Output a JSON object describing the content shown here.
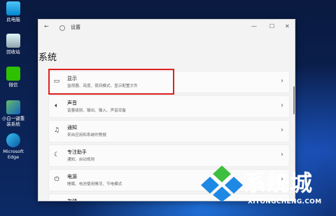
{
  "desktop": {
    "icons": [
      {
        "label": "此电脑"
      },
      {
        "label": "回收站"
      },
      {
        "label": "微信"
      },
      {
        "label": "小白一键重装系统"
      },
      {
        "label": "Microsoft Edge"
      }
    ]
  },
  "window": {
    "title": "设置",
    "controls": {
      "minimize": "—",
      "maximize": "☐",
      "close": "✕"
    },
    "nav": {
      "back": "←"
    }
  },
  "page": {
    "title": "系统"
  },
  "items": [
    {
      "title": "显示",
      "subtitle": "监视器、亮度、夜间模式、显示配置文件",
      "icon": "display-icon"
    },
    {
      "title": "声音",
      "subtitle": "音量级别、输出、输入、声音设备",
      "icon": "speaker-icon"
    },
    {
      "title": "通知",
      "subtitle": "来自应用和系统的警报",
      "icon": "bell-icon"
    },
    {
      "title": "专注助手",
      "subtitle": "通知、自动规则",
      "icon": "moon-icon"
    },
    {
      "title": "电源",
      "subtitle": "睡眠、电池使用情况、节电模式",
      "icon": "power-icon"
    },
    {
      "title": "存储",
      "subtitle": "",
      "icon": "storage-icon"
    }
  ],
  "watermark": {
    "text": "系统城",
    "url": "XITONGCHENG.COM",
    "colors": {
      "blue": "#1e88e5",
      "green": "#3fbf3f"
    }
  }
}
